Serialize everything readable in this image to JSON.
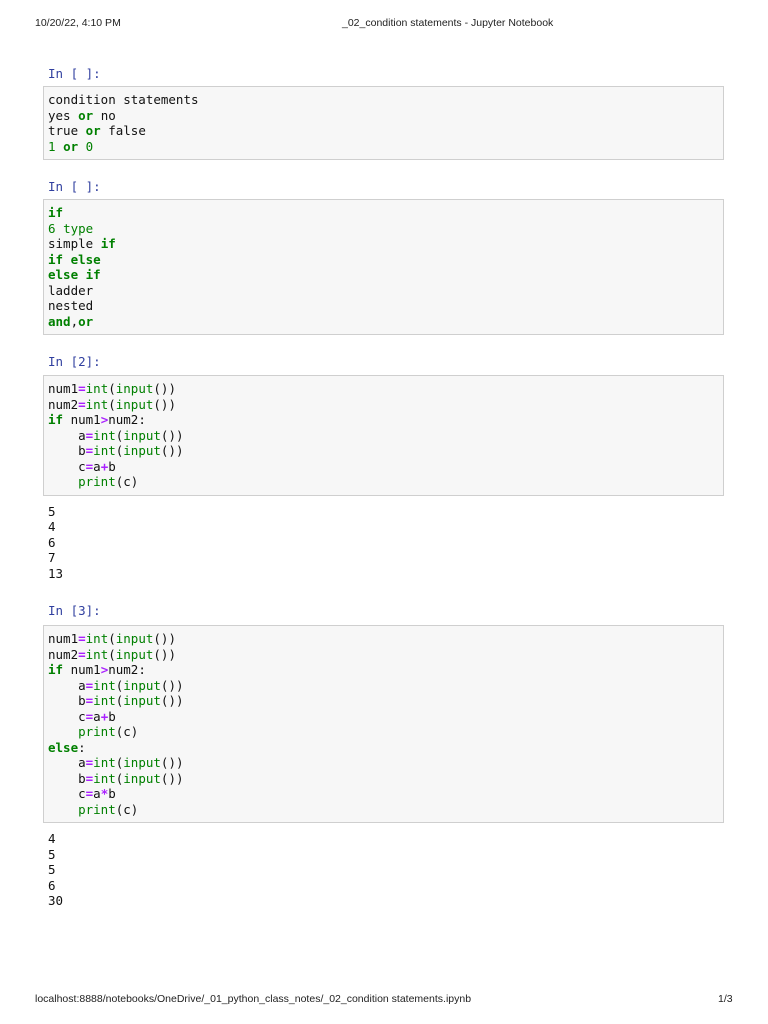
{
  "header": {
    "datetime": "10/20/22, 4:10 PM",
    "title": "_02_condition statements - Jupyter Notebook"
  },
  "footer": {
    "url": "localhost:8888/notebooks/OneDrive/_01_python_class_notes/_02_condition statements.ipynb",
    "page": "1/3"
  },
  "colors": {
    "keyword": "#008000",
    "operator": "#aa22ff",
    "prompt": "#303f9f"
  },
  "cells": [
    {
      "prompt": "In [ ]:",
      "code": [
        [
          [
            "condition statements",
            "n"
          ]
        ],
        [
          [
            "yes ",
            "n"
          ],
          [
            "or",
            "k"
          ],
          [
            " no",
            "n"
          ]
        ],
        [
          [
            "true ",
            "n"
          ],
          [
            "or",
            "k"
          ],
          [
            " false",
            "n"
          ]
        ],
        [
          [
            "1",
            "m"
          ],
          [
            " ",
            "n"
          ],
          [
            "or",
            "k"
          ],
          [
            " ",
            "n"
          ],
          [
            "0",
            "m"
          ]
        ]
      ],
      "output": []
    },
    {
      "prompt": "In [ ]:",
      "code": [
        [
          [
            "if",
            "k"
          ]
        ],
        [
          [
            "6",
            "m"
          ],
          [
            " ",
            "n"
          ],
          [
            "type",
            "b"
          ]
        ],
        [
          [
            "simple ",
            "n"
          ],
          [
            "if",
            "k"
          ]
        ],
        [
          [
            "if",
            "k"
          ],
          [
            " ",
            "n"
          ],
          [
            "else",
            "k"
          ]
        ],
        [
          [
            "else",
            "k"
          ],
          [
            " ",
            "n"
          ],
          [
            "if",
            "k"
          ]
        ],
        [
          [
            "ladder",
            "n"
          ]
        ],
        [
          [
            "nested",
            "n"
          ]
        ],
        [
          [
            "and",
            "k"
          ],
          [
            ",",
            "n"
          ],
          [
            "or",
            "k"
          ]
        ]
      ],
      "output": []
    },
    {
      "prompt": "In [2]:",
      "code": [
        [
          [
            "num1",
            "n"
          ],
          [
            "=",
            "o"
          ],
          [
            "int",
            "b"
          ],
          [
            "(",
            "n"
          ],
          [
            "input",
            "b"
          ],
          [
            "())",
            "n"
          ]
        ],
        [
          [
            "num2",
            "n"
          ],
          [
            "=",
            "o"
          ],
          [
            "int",
            "b"
          ],
          [
            "(",
            "n"
          ],
          [
            "input",
            "b"
          ],
          [
            "())",
            "n"
          ]
        ],
        [
          [
            "if",
            "k"
          ],
          [
            " num1",
            "n"
          ],
          [
            ">",
            "o"
          ],
          [
            "num2:",
            "n"
          ]
        ],
        [
          [
            "    a",
            "n"
          ],
          [
            "=",
            "o"
          ],
          [
            "int",
            "b"
          ],
          [
            "(",
            "n"
          ],
          [
            "input",
            "b"
          ],
          [
            "())",
            "n"
          ]
        ],
        [
          [
            "    b",
            "n"
          ],
          [
            "=",
            "o"
          ],
          [
            "int",
            "b"
          ],
          [
            "(",
            "n"
          ],
          [
            "input",
            "b"
          ],
          [
            "())",
            "n"
          ]
        ],
        [
          [
            "    c",
            "n"
          ],
          [
            "=",
            "o"
          ],
          [
            "a",
            "n"
          ],
          [
            "+",
            "o"
          ],
          [
            "b",
            "n"
          ]
        ],
        [
          [
            "    ",
            "n"
          ],
          [
            "print",
            "b"
          ],
          [
            "(c)",
            "n"
          ]
        ]
      ],
      "output": [
        "5",
        "4",
        "6",
        "7",
        "13"
      ]
    },
    {
      "prompt": "In [3]:",
      "code": [
        [
          [
            "num1",
            "n"
          ],
          [
            "=",
            "o"
          ],
          [
            "int",
            "b"
          ],
          [
            "(",
            "n"
          ],
          [
            "input",
            "b"
          ],
          [
            "())",
            "n"
          ]
        ],
        [
          [
            "num2",
            "n"
          ],
          [
            "=",
            "o"
          ],
          [
            "int",
            "b"
          ],
          [
            "(",
            "n"
          ],
          [
            "input",
            "b"
          ],
          [
            "())",
            "n"
          ]
        ],
        [
          [
            "if",
            "k"
          ],
          [
            " num1",
            "n"
          ],
          [
            ">",
            "o"
          ],
          [
            "num2:",
            "n"
          ]
        ],
        [
          [
            "    a",
            "n"
          ],
          [
            "=",
            "o"
          ],
          [
            "int",
            "b"
          ],
          [
            "(",
            "n"
          ],
          [
            "input",
            "b"
          ],
          [
            "())",
            "n"
          ]
        ],
        [
          [
            "    b",
            "n"
          ],
          [
            "=",
            "o"
          ],
          [
            "int",
            "b"
          ],
          [
            "(",
            "n"
          ],
          [
            "input",
            "b"
          ],
          [
            "())",
            "n"
          ]
        ],
        [
          [
            "    c",
            "n"
          ],
          [
            "=",
            "o"
          ],
          [
            "a",
            "n"
          ],
          [
            "+",
            "o"
          ],
          [
            "b",
            "n"
          ]
        ],
        [
          [
            "    ",
            "n"
          ],
          [
            "print",
            "b"
          ],
          [
            "(c)",
            "n"
          ]
        ],
        [
          [
            "else",
            "k"
          ],
          [
            ":",
            "n"
          ]
        ],
        [
          [
            "    a",
            "n"
          ],
          [
            "=",
            "o"
          ],
          [
            "int",
            "b"
          ],
          [
            "(",
            "n"
          ],
          [
            "input",
            "b"
          ],
          [
            "())",
            "n"
          ]
        ],
        [
          [
            "    b",
            "n"
          ],
          [
            "=",
            "o"
          ],
          [
            "int",
            "b"
          ],
          [
            "(",
            "n"
          ],
          [
            "input",
            "b"
          ],
          [
            "())",
            "n"
          ]
        ],
        [
          [
            "    c",
            "n"
          ],
          [
            "=",
            "o"
          ],
          [
            "a",
            "n"
          ],
          [
            "*",
            "o"
          ],
          [
            "b",
            "n"
          ]
        ],
        [
          [
            "    ",
            "n"
          ],
          [
            "print",
            "b"
          ],
          [
            "(c)",
            "n"
          ]
        ]
      ],
      "output": [
        "4",
        "5",
        "5",
        "6",
        "30"
      ]
    }
  ]
}
